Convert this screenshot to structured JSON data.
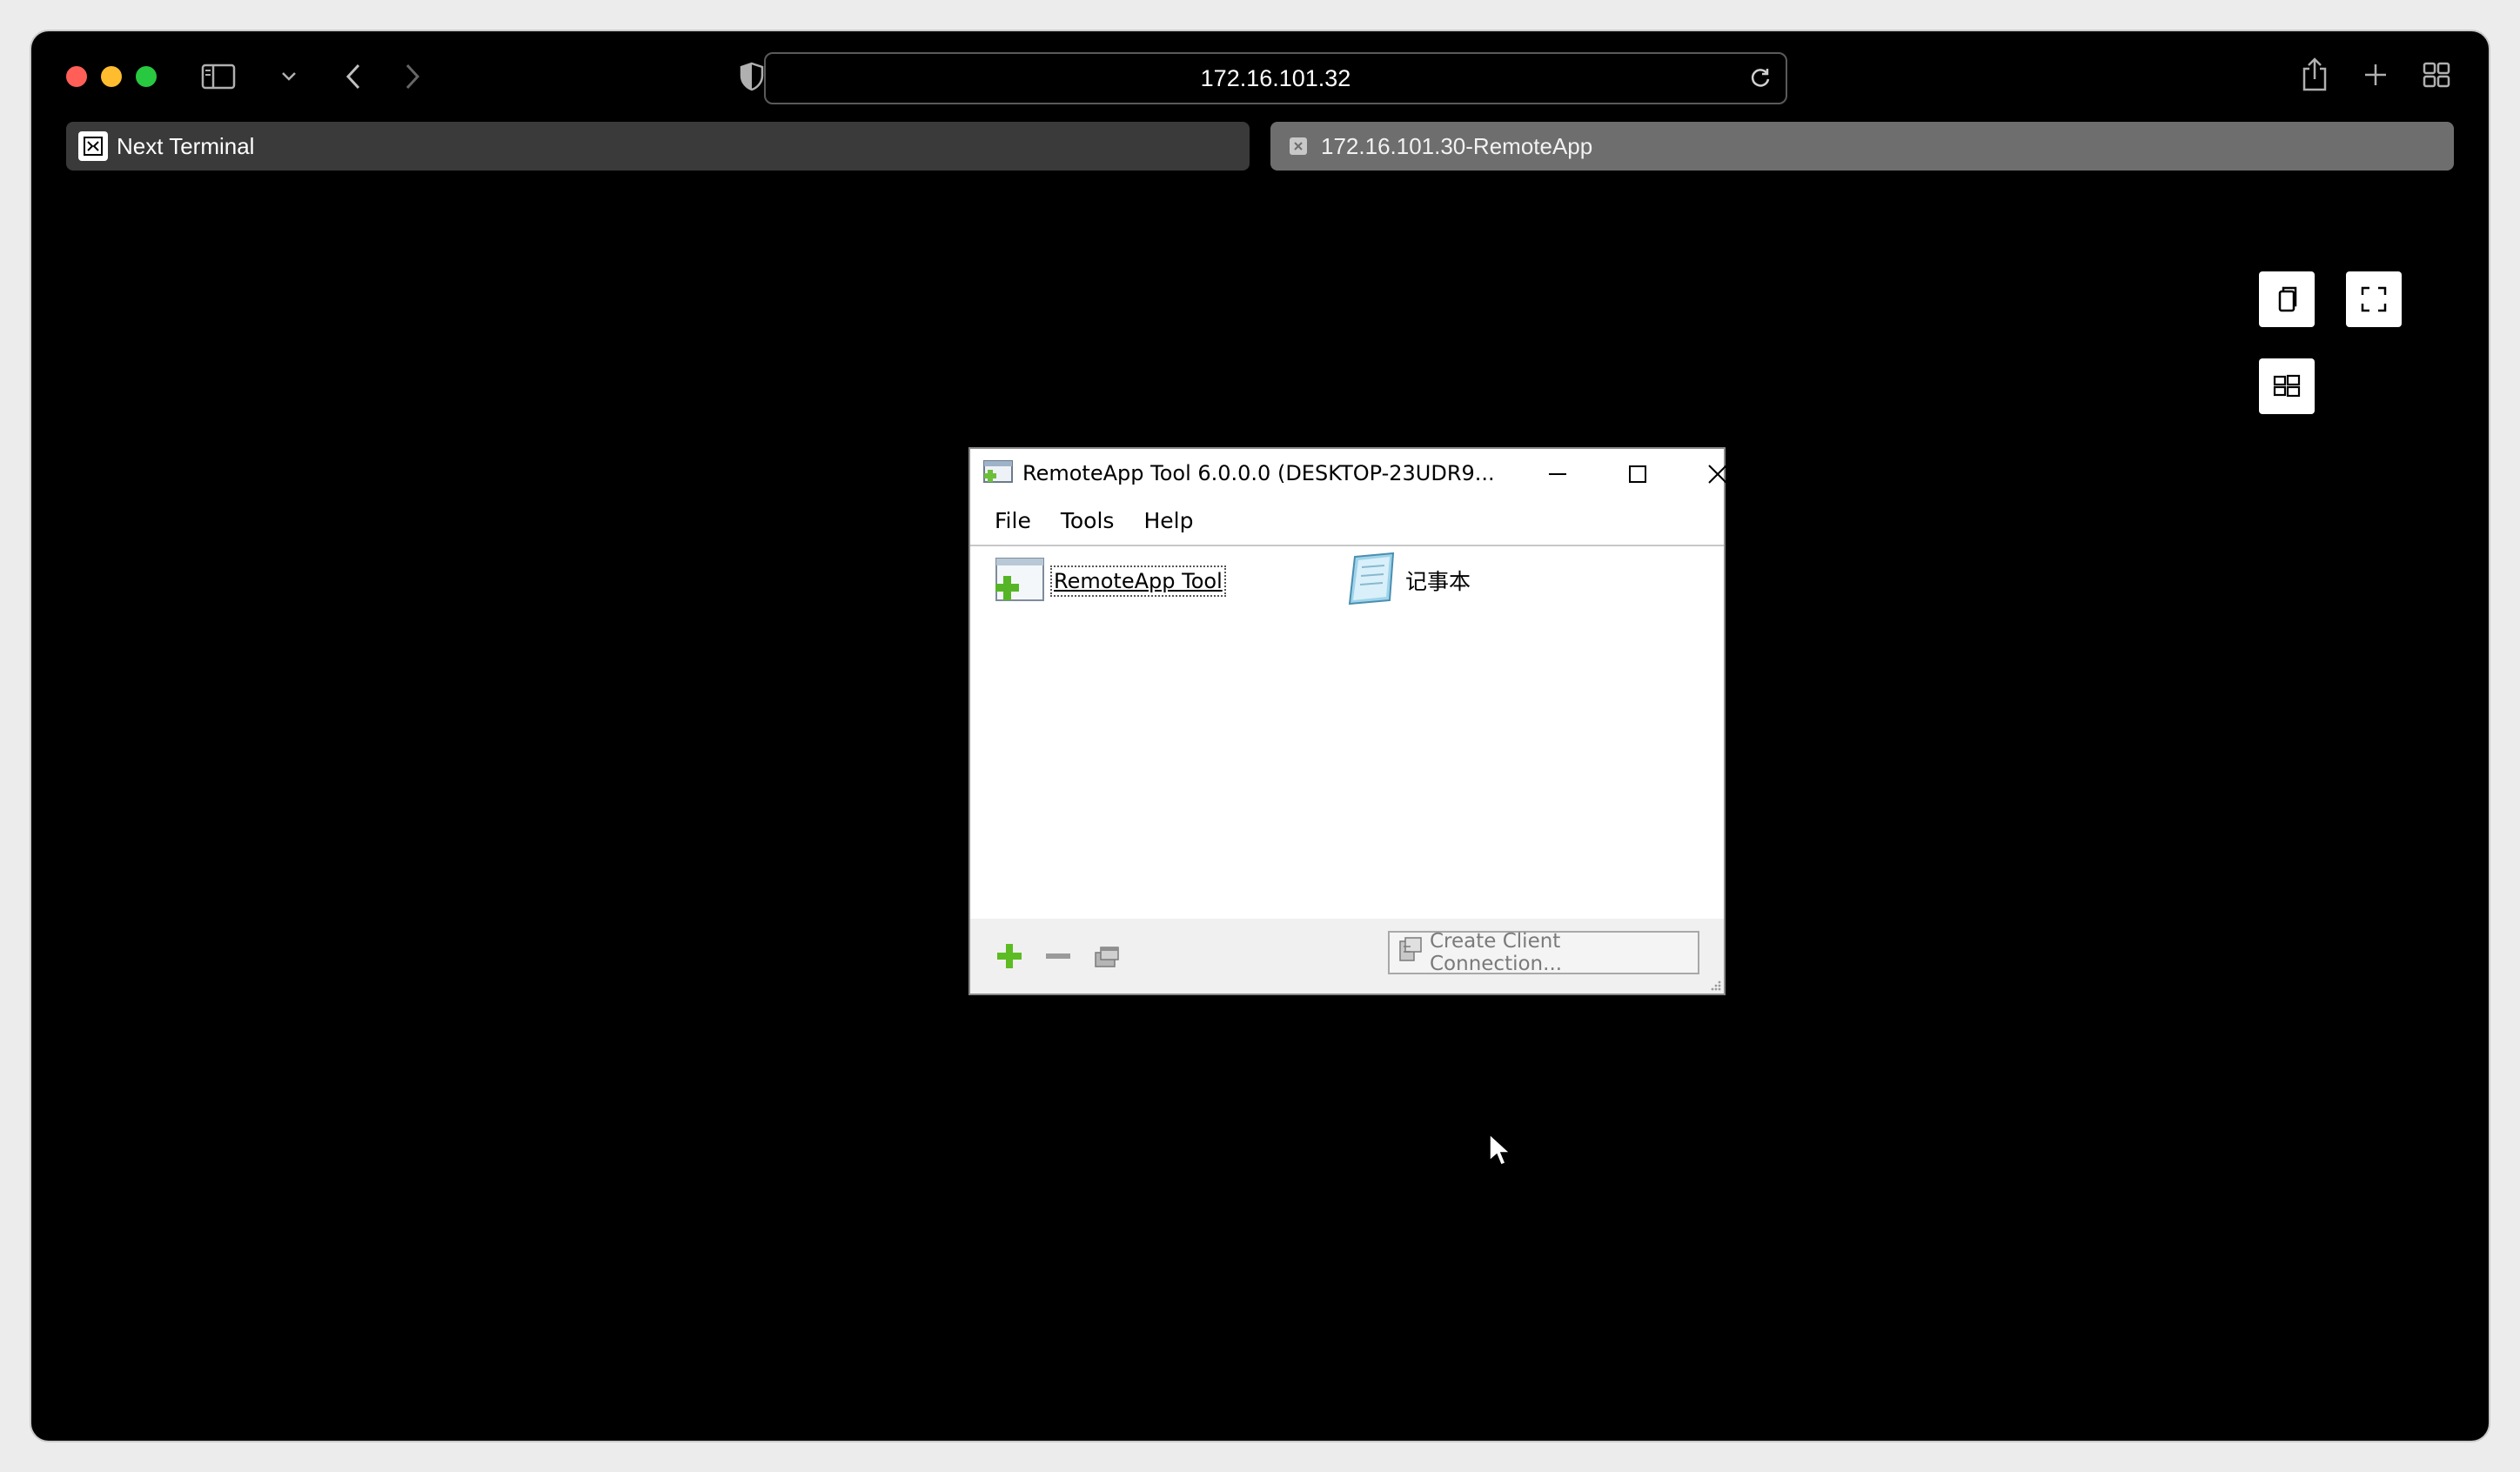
{
  "browser": {
    "url": "172.16.101.32",
    "tabs": [
      {
        "label": "Next Terminal",
        "active": true
      },
      {
        "label": "172.16.101.30-RemoteApp",
        "active": false
      }
    ]
  },
  "remote_window": {
    "title": "RemoteApp Tool 6.0.0.0 (DESKTOP-23UDR9...",
    "menu": [
      "File",
      "Tools",
      "Help"
    ],
    "apps": [
      {
        "label": "RemoteApp Tool",
        "icon": "remoteapp-tool-icon"
      },
      {
        "label": "记事本",
        "icon": "notepad-icon"
      }
    ],
    "create_connection_label": "Create Client Connection..."
  },
  "colors": {
    "close": "#ff5f57",
    "minimize": "#febc2e",
    "maximize": "#28c840",
    "tab_active": "#3a3a3a",
    "tab_inactive": "#6e6e6e"
  }
}
